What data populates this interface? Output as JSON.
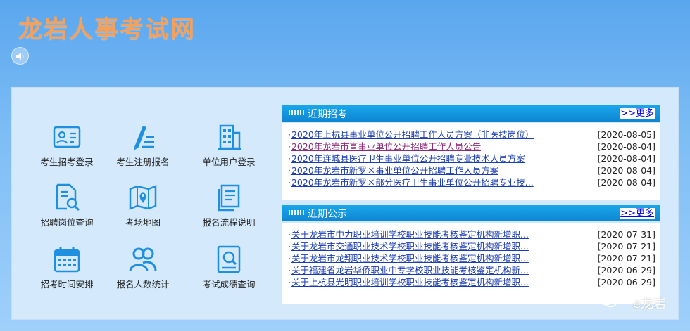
{
  "header": {
    "site_title": "龙岩人事考试网"
  },
  "quick_links": [
    {
      "label": "考生招考登录",
      "icon": "id-card-icon"
    },
    {
      "label": "考生注册报名",
      "icon": "pen-list-icon"
    },
    {
      "label": "单位用户登录",
      "icon": "building-icon"
    },
    {
      "label": "招聘岗位查询",
      "icon": "document-search-icon"
    },
    {
      "label": "考场地图",
      "icon": "map-pin-icon"
    },
    {
      "label": "报名流程说明",
      "icon": "documents-icon"
    },
    {
      "label": "招考时间安排",
      "icon": "calendar-icon"
    },
    {
      "label": "报名人数统计",
      "icon": "users-icon"
    },
    {
      "label": "考试成绩查询",
      "icon": "certificate-search-icon"
    }
  ],
  "recent_recruitment": {
    "title": "近期招考",
    "more_label": ">>更多",
    "items": [
      {
        "text": "2020年上杭县事业单位公开招聘工作人员方案（非医技岗位）",
        "date": "[2020-08-05]",
        "visited": false
      },
      {
        "text": "2020年龙岩市直事业单位公开招聘工作人员公告",
        "date": "[2020-08-04]",
        "visited": true
      },
      {
        "text": "2020年连城县医疗卫生事业单位公开招聘专业技术人员方案",
        "date": "[2020-08-04]",
        "visited": false
      },
      {
        "text": "2020年龙岩市新罗区事业单位公开招聘工作人员方案",
        "date": "[2020-08-04]",
        "visited": false
      },
      {
        "text": "2020年龙岩市新罗区部分医疗卫生事业单位公开招聘专业技...",
        "date": "[2020-08-04]",
        "visited": false
      }
    ]
  },
  "recent_notices": {
    "title": "近期公示",
    "more_label": ">>更多",
    "items": [
      {
        "text": "关于龙岩市中力职业培训学校职业技能考核鉴定机构新增职...",
        "date": "[2020-07-31]",
        "visited": false
      },
      {
        "text": "关于龙岩市交通职业技术学校职业技能考核鉴定机构新增职...",
        "date": "[2020-07-21]",
        "visited": false
      },
      {
        "text": "关于龙岩市龙翔职业技术学校职业技能考核鉴定机构新增职...",
        "date": "[2020-07-21]",
        "visited": false
      },
      {
        "text": "关于福建省龙岩华侨职业中专学校职业技能考核鉴定机构新...",
        "date": "[2020-06-29]",
        "visited": false
      },
      {
        "text": "关于上杭县光明职业培训学校职业技能考核鉴定机构新增职...",
        "date": "[2020-06-29]",
        "visited": false
      }
    ]
  },
  "watermark": {
    "text": "e龙岩",
    "icon": "wechat-icon"
  },
  "colors": {
    "title": "#f5a15c",
    "icon_blue": "#1f8fe0",
    "link": "#1a3db3",
    "header_bar": "#0e86d3"
  }
}
